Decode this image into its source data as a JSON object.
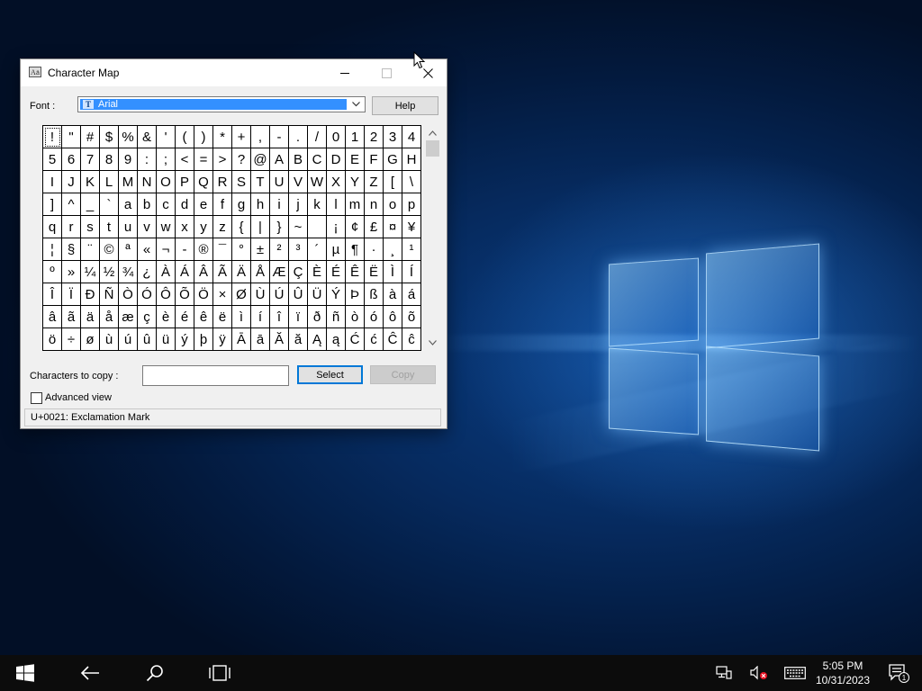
{
  "window": {
    "title": "Character Map",
    "font_label": "Font :",
    "font_value": "Arial",
    "help_label": "Help",
    "characters": [
      "!",
      "\"",
      "#",
      "$",
      "%",
      "&",
      "'",
      "(",
      ")",
      "*",
      "+",
      ",",
      "-",
      ".",
      "/",
      "0",
      "1",
      "2",
      "3",
      "4",
      "5",
      "6",
      "7",
      "8",
      "9",
      ":",
      ";",
      "<",
      "=",
      ">",
      "?",
      "@",
      "A",
      "B",
      "C",
      "D",
      "E",
      "F",
      "G",
      "H",
      "I",
      "J",
      "K",
      "L",
      "M",
      "N",
      "O",
      "P",
      "Q",
      "R",
      "S",
      "T",
      "U",
      "V",
      "W",
      "X",
      "Y",
      "Z",
      "[",
      "\\",
      "]",
      "^",
      "_",
      "`",
      "a",
      "b",
      "c",
      "d",
      "e",
      "f",
      "g",
      "h",
      "i",
      "j",
      "k",
      "l",
      "m",
      "n",
      "o",
      "p",
      "q",
      "r",
      "s",
      "t",
      "u",
      "v",
      "w",
      "x",
      "y",
      "z",
      "{",
      "|",
      "}",
      "~",
      " ",
      "¡",
      "¢",
      "£",
      "¤",
      "¥",
      "¦",
      "§",
      "¨",
      "©",
      "ª",
      "«",
      "¬",
      "-",
      "®",
      "¯",
      "°",
      "±",
      "²",
      "³",
      "´",
      "µ",
      "¶",
      "·",
      "¸",
      "¹",
      "º",
      "»",
      "¼",
      "½",
      "¾",
      "¿",
      "À",
      "Á",
      "Â",
      "Ã",
      "Ä",
      "Å",
      "Æ",
      "Ç",
      "È",
      "É",
      "Ê",
      "Ë",
      "Ì",
      "Í",
      "Î",
      "Ï",
      "Ð",
      "Ñ",
      "Ò",
      "Ó",
      "Ô",
      "Õ",
      "Ö",
      "×",
      "Ø",
      "Ù",
      "Ú",
      "Û",
      "Ü",
      "Ý",
      "Þ",
      "ß",
      "à",
      "á",
      "â",
      "ã",
      "ä",
      "å",
      "æ",
      "ç",
      "è",
      "é",
      "ê",
      "ë",
      "ì",
      "í",
      "î",
      "ï",
      "ð",
      "ñ",
      "ò",
      "ó",
      "ô",
      "õ",
      "ö",
      "÷",
      "ø",
      "ù",
      "ú",
      "û",
      "ü",
      "ý",
      "þ",
      "ÿ",
      "Ā",
      "ā",
      "Ă",
      "ă",
      "Ą",
      "ą",
      "Ć",
      "ć",
      "Ĉ",
      "ĉ"
    ],
    "selected_index": 0,
    "copy_label": "Characters to copy :",
    "copy_value": "",
    "select_label": "Select",
    "copy_button_label": "Copy",
    "advanced_label": "Advanced view",
    "advanced_checked": false,
    "status": "U+0021: Exclamation Mark"
  },
  "taskbar": {
    "time": "5:05 PM",
    "date": "10/31/2023",
    "notification_count": "1"
  },
  "icons": {
    "app": "character-map-icon",
    "start": "windows-logo-icon",
    "back": "back-arrow-icon",
    "search": "search-icon",
    "task_view": "task-view-icon",
    "network": "network-icon",
    "volume": "volume-muted-icon",
    "keyboard": "keyboard-icon",
    "notifications": "action-center-icon"
  },
  "colors": {
    "accent": "#0078d7",
    "selection": "#3390ff",
    "taskbar": "#0c0c0c"
  }
}
